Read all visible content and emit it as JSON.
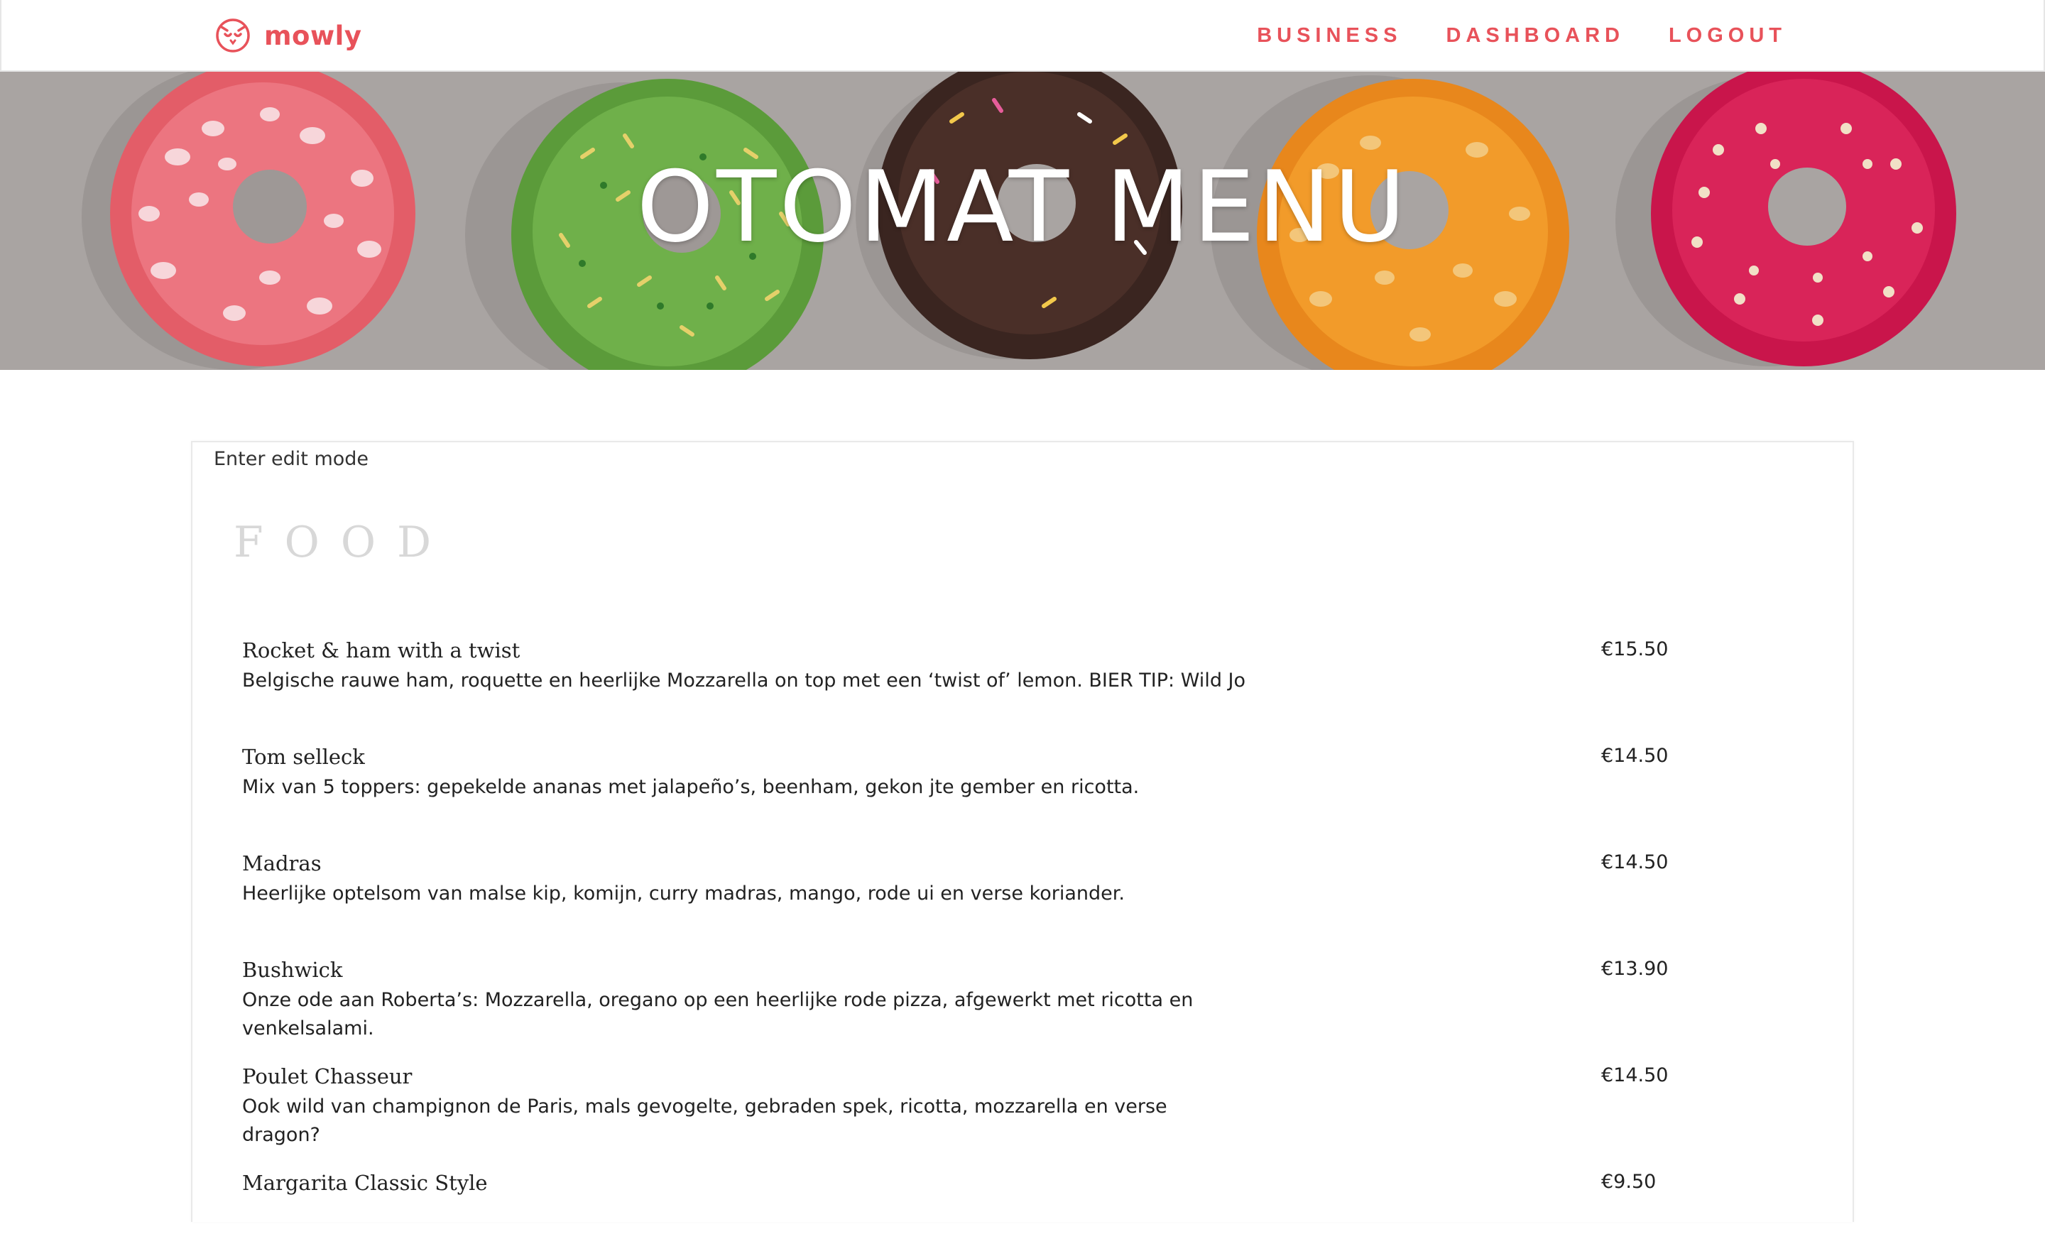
{
  "brand": {
    "name": "mowly",
    "color": "#e8525a",
    "icon": "owl-logo-icon"
  },
  "nav": {
    "items": [
      {
        "label": "BUSINESS"
      },
      {
        "label": "DASHBOARD"
      },
      {
        "label": "LOGOUT"
      }
    ]
  },
  "hero": {
    "title": "OTOMAT MENU",
    "background": "donuts-photo"
  },
  "menu": {
    "edit_label": "Enter edit mode",
    "section_title": "FOOD",
    "items": [
      {
        "name": "Rocket & ham with a twist",
        "description": "Belgische rauwe ham, roquette en heerlijke Mozzarella on top met een ‘twist of’ lemon. BIER TIP: Wild Jo",
        "price": "€15.50"
      },
      {
        "name": "Tom selleck",
        "description": "Mix van 5 toppers: gepekelde ananas met jalapeño’s, beenham, gekon jte gember en ricotta.",
        "price": "€14.50"
      },
      {
        "name": "Madras",
        "description": "Heerlijke optelsom van malse kip, komijn, curry madras, mango, rode ui en verse koriander.",
        "price": "€14.50"
      },
      {
        "name": "Bushwick",
        "description": "Onze ode aan Roberta’s: Mozzarella, oregano op een heerlijke rode pizza, afgewerkt met ricotta en venkelsalami.",
        "price": "€13.90"
      },
      {
        "name": "Poulet Chasseur",
        "description": "Ook wild van champignon de Paris, mals gevogelte, gebraden spek, ricotta, mozzarella en verse dragon?",
        "price": "€14.50"
      },
      {
        "name": "Margarita Classic Style",
        "description": "",
        "price": "€9.50"
      }
    ]
  }
}
